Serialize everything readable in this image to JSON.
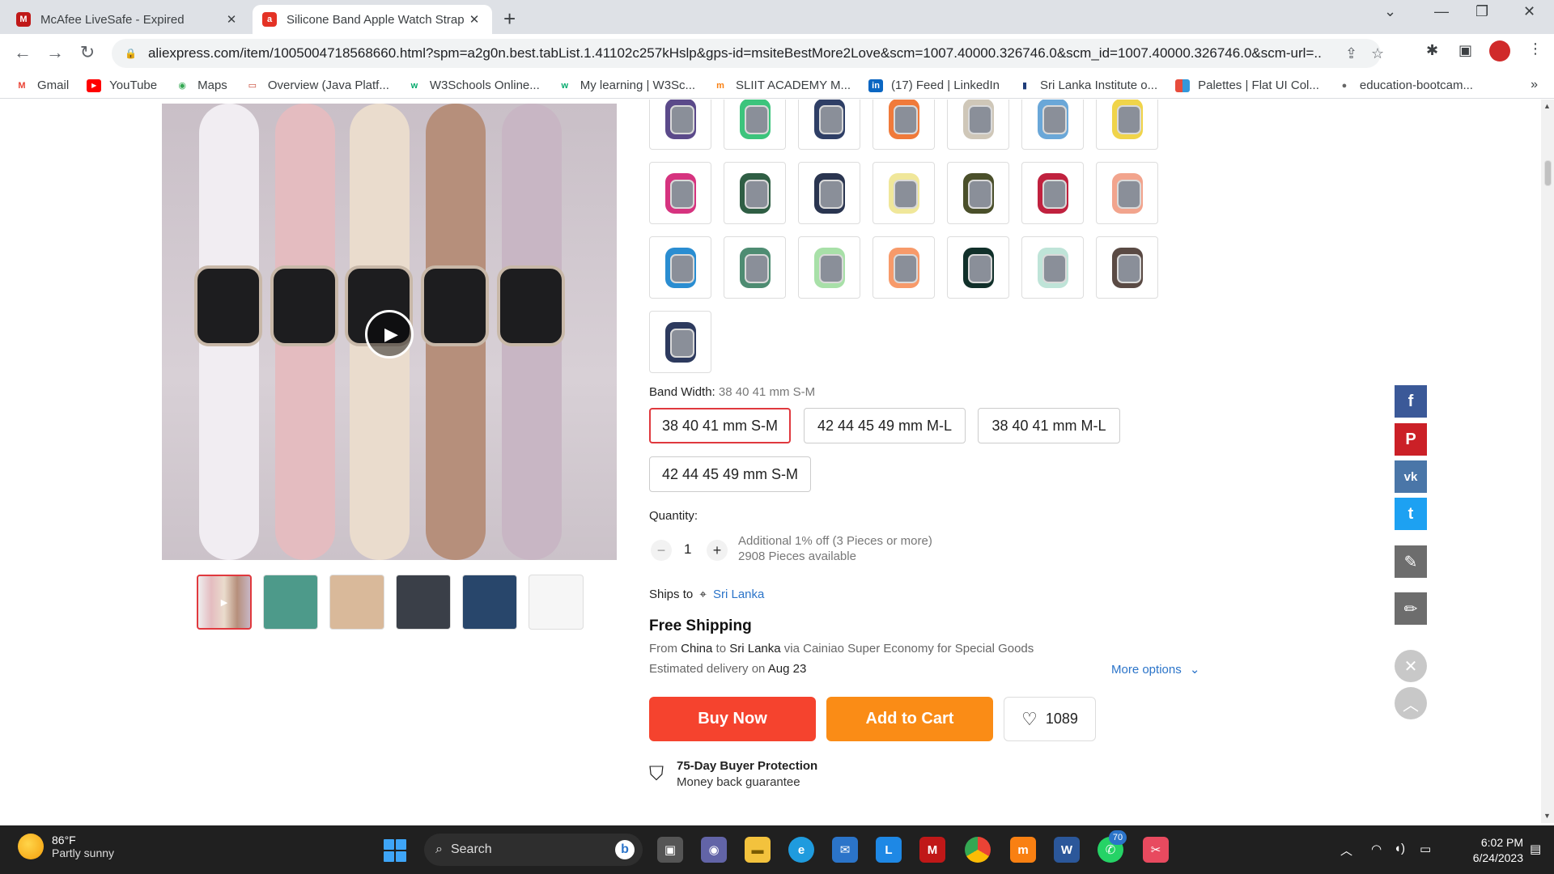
{
  "browser": {
    "tabs": [
      {
        "title": "McAfee LiveSafe - Expired",
        "active": false
      },
      {
        "title": "Silicone Band Apple Watch Strap",
        "active": true
      }
    ],
    "url": "aliexpress.com/item/1005004718568660.html?spm=a2g0n.best.tabList.1.41102c257kHslp&gps-id=msiteBestMore2Love&scm=1007.40000.326746.0&scm_id=1007.40000.326746.0&scm-url=...",
    "bookmarks": [
      {
        "label": "Gmail",
        "icon": "gmail-icon",
        "color": "#ea4335",
        "glyph": "M"
      },
      {
        "label": "YouTube",
        "icon": "youtube-icon",
        "color": "#ff0000",
        "glyph": "▶"
      },
      {
        "label": "Maps",
        "icon": "maps-icon",
        "color": "#34a853",
        "glyph": "◉"
      },
      {
        "label": "Overview (Java Platf...",
        "icon": "oracle-icon",
        "color": "#c74634",
        "glyph": "▭"
      },
      {
        "label": "W3Schools Online...",
        "icon": "w3schools-icon",
        "color": "#04aa6d",
        "glyph": "w"
      },
      {
        "label": "My learning | W3Sc...",
        "icon": "w3schools-icon",
        "color": "#04aa6d",
        "glyph": "w"
      },
      {
        "label": "SLIIT ACADEMY M...",
        "icon": "moodle-icon",
        "color": "#f98012",
        "glyph": "m"
      },
      {
        "label": "(17) Feed | LinkedIn",
        "icon": "linkedin-icon",
        "color": "#0a66c2",
        "glyph": "in"
      },
      {
        "label": "Sri Lanka Institute o...",
        "icon": "sliit-icon",
        "color": "#1f3d7a",
        "glyph": "▮"
      },
      {
        "label": "Palettes | Flat UI Col...",
        "icon": "palette-icon",
        "color": "#e74c3c",
        "glyph": "■"
      },
      {
        "label": "education-bootcam...",
        "icon": "github-icon",
        "color": "#666666",
        "glyph": "●"
      }
    ]
  },
  "product": {
    "swatch_colors": [
      "#5b4a8a",
      "#3cc47c",
      "#2f3f66",
      "#f07a3a",
      "#cfc7b8",
      "#6aa7d8",
      "#f0d44a",
      "#d6337f",
      "#2f5e44",
      "#2a3550",
      "#f0e79a",
      "#4a4f2a",
      "#c0213e",
      "#f2a48d",
      "#2a8dd1",
      "#4e8c72",
      "#a8e0a8",
      "#f79a6a",
      "#11302a",
      "#bfe4d8",
      "#5a4a44",
      "#2d3a5e"
    ],
    "band_width_label": "Band Width:",
    "band_width_selected": "38 40 41 mm S-M",
    "sizes": [
      "38 40 41 mm S-M",
      "42 44 45 49 mm M-L",
      "38 40 41 mm M-L",
      "42 44 45 49 mm S-M"
    ],
    "quantity_label": "Quantity:",
    "quantity": "1",
    "discount_note": "Additional 1% off (3 Pieces or more)",
    "stock": "2908 Pieces available",
    "ships_to_label": "Ships to",
    "ships_to": "Sri Lanka",
    "shipping_title": "Free Shipping",
    "from_prefix": "From",
    "from": "China",
    "to_prefix": "to",
    "to": "Sri Lanka",
    "via": "via Cainiao Super Economy for Special Goods",
    "estimated_prefix": "Estimated delivery on",
    "estimated_date": "Aug 23",
    "more_options": "More options",
    "buy_now": "Buy Now",
    "add_to_cart": "Add to Cart",
    "wishlist_count": "1089",
    "protection_title": "75-Day Buyer Protection",
    "protection_sub": "Money back guarantee"
  },
  "taskbar": {
    "temperature": "86°F",
    "weather": "Partly sunny",
    "search": "Search",
    "whatsapp_badge": "70",
    "time": "6:02 PM",
    "date": "6/24/2023"
  }
}
